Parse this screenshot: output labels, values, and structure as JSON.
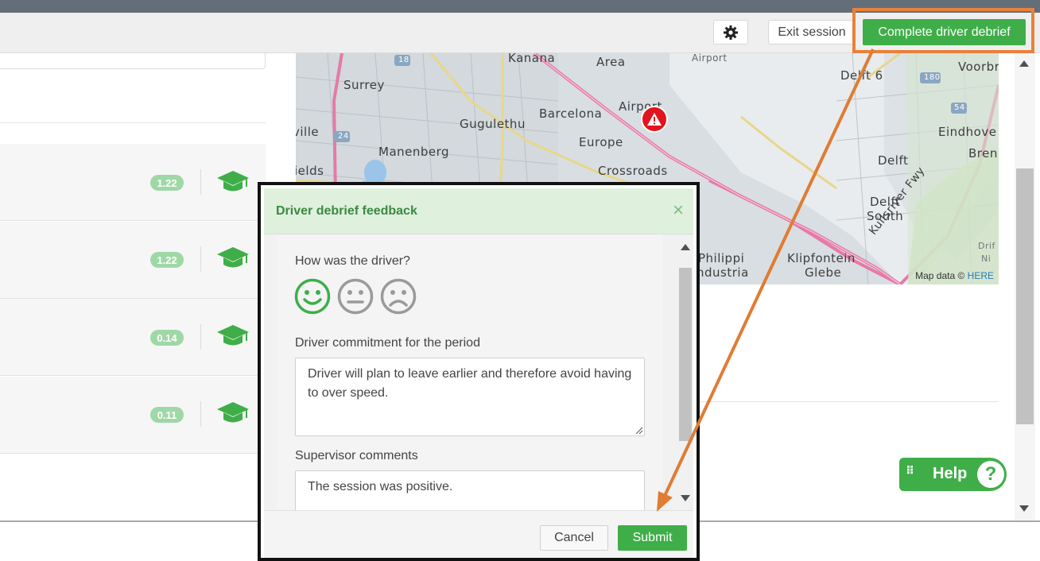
{
  "toolbar": {
    "exit_label": "Exit session",
    "complete_label": "Complete driver debrief",
    "settings_icon": "gear-icon"
  },
  "rows": [
    {
      "score": "1.22",
      "icon": "graduation-cap-icon"
    },
    {
      "score": "1.22",
      "icon": "graduation-cap-icon"
    },
    {
      "score": "0.14",
      "icon": "graduation-cap-icon"
    },
    {
      "score": "0.11",
      "icon": "graduation-cap-icon"
    }
  ],
  "map": {
    "labels": [
      "Kanana",
      "Area",
      "Airport",
      "Delft 6",
      "Voorbru",
      "Surrey",
      "Barcelona",
      "Airport",
      "Gugulethu",
      "Eindhove",
      "Bren",
      "ville",
      "Manenberg",
      "Europe",
      "Delft",
      "ields",
      "Crossroads",
      "Delft",
      "South",
      "Kuilsriver Fwy",
      "Philippi",
      "ndustria",
      "Klipfontein",
      "Glebe",
      "Drif",
      "Ni"
    ],
    "shields": [
      "18",
      "24",
      "180",
      "54"
    ],
    "attribution": "Map data ©",
    "attribution_link": "HERE",
    "marker_icon": "warning-icon"
  },
  "help": {
    "label": "Help",
    "q": "?"
  },
  "modal": {
    "title": "Driver debrief feedback",
    "close": "×",
    "q_driver": "How was the driver?",
    "faces": [
      "happy-face-icon",
      "neutral-face-icon",
      "sad-face-icon"
    ],
    "selected_face": "happy",
    "commitment_label": "Driver commitment for the period",
    "commitment_value": "Driver will plan to leave earlier and therefore avoid having to over speed.",
    "supervisor_label": "Supervisor comments",
    "supervisor_value": "The session was positive.",
    "cancel_label": "Cancel",
    "submit_label": "Submit"
  },
  "colors": {
    "accent_green": "#3fae49",
    "highlight_orange": "#e8823a",
    "alert_red": "#e3141e",
    "header_green_bg": "#dff0dd"
  }
}
